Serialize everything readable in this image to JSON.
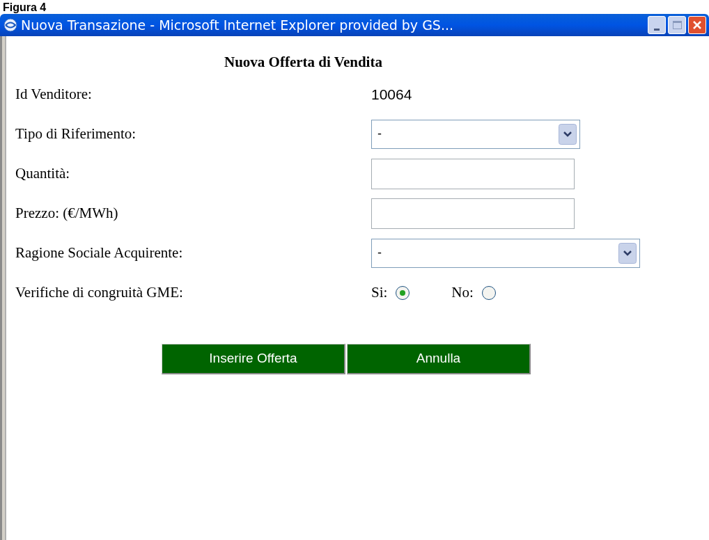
{
  "caption": "Figura 4",
  "window": {
    "title": "Nuova Transazione - Microsoft Internet Explorer provided by GS..."
  },
  "form": {
    "title": "Nuova Offerta di Vendita",
    "fields": [
      {
        "kind": "text",
        "label": "Id Venditore:",
        "value": "10064"
      },
      {
        "kind": "select",
        "label": "Tipo di Riferimento:",
        "value": "-"
      },
      {
        "kind": "input",
        "label": "Quantità:"
      },
      {
        "kind": "input",
        "label": "Prezzo: (€/MWh)"
      },
      {
        "kind": "wideselect",
        "label": "Ragione Sociale Acquirente:",
        "value": "-"
      },
      {
        "kind": "radio",
        "label": "Verifiche di congruità GME:",
        "options": [
          {
            "label": "Si:",
            "selected": true
          },
          {
            "label": "No:",
            "selected": false
          }
        ]
      }
    ],
    "buttons": [
      "Inserire Offerta",
      "Annulla"
    ]
  }
}
